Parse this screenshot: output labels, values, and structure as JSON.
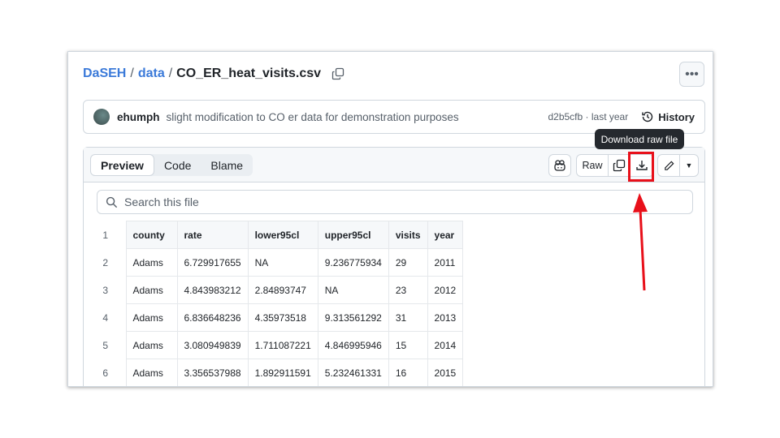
{
  "breadcrumb": {
    "repo": "DaSEH",
    "folder": "data",
    "file": "CO_ER_heat_visits.csv"
  },
  "commit": {
    "author": "ehumph",
    "message": "slight modification to CO er data for demonstration purposes",
    "sha_time": "d2b5cfb · last year",
    "history_label": "History"
  },
  "tabs": [
    "Preview",
    "Code",
    "Blame"
  ],
  "toolbar": {
    "raw_label": "Raw",
    "tooltip": "Download raw file"
  },
  "search": {
    "placeholder": "Search this file"
  },
  "table": {
    "headers": [
      "county",
      "rate",
      "lower95cl",
      "upper95cl",
      "visits",
      "year"
    ],
    "rows": [
      [
        "Adams",
        "6.729917655",
        "NA",
        "9.236775934",
        "29",
        "2011"
      ],
      [
        "Adams",
        "4.843983212",
        "2.84893747",
        "NA",
        "23",
        "2012"
      ],
      [
        "Adams",
        "6.836648236",
        "4.35973518",
        "9.313561292",
        "31",
        "2013"
      ],
      [
        "Adams",
        "3.080949839",
        "1.711087221",
        "4.846995946",
        "15",
        "2014"
      ],
      [
        "Adams",
        "3.356537988",
        "1.892911591",
        "5.232461331",
        "16",
        "2015"
      ]
    ]
  },
  "colors": {
    "annotation": "#e8101a",
    "link": "#3b7ad9"
  }
}
